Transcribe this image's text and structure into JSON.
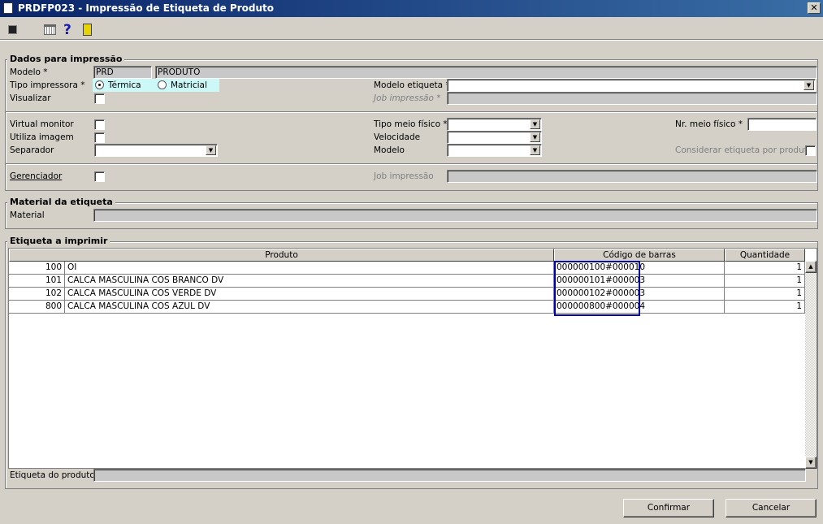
{
  "window": {
    "title": "PRDFP023 - Impressão de Etiqueta de Produto",
    "close": "✕"
  },
  "toolbar": {
    "icons": [
      "export-icon",
      "calendar-icon",
      "help-icon",
      "exit-icon"
    ],
    "help_glyph": "?"
  },
  "dados": {
    "title": "Dados para impressão",
    "modelo_label": "Modelo *",
    "modelo_code": "PRD",
    "modelo_desc": "PRODUTO",
    "tipo_label": "Tipo impressora *",
    "termica": "Térmica",
    "matricial": "Matricial",
    "selected": "Térmica",
    "visualizar_label": "Visualizar",
    "modelo_etiqueta_label": "Modelo etiqueta *",
    "job_label": "Job impressão *",
    "virtual_label": "Virtual monitor",
    "utiliza_label": "Utiliza imagem",
    "separador_label": "Separador",
    "tipo_meio_label": "Tipo meio físico *",
    "velocidade_label": "Velocidade",
    "modelo2_label": "Modelo",
    "nr_meio_label": "Nr. meio físico *",
    "considerar_label": "Considerar etiqueta por produto",
    "gerenciador_label": "Gerenciador",
    "job2_label": "Job impressão"
  },
  "material": {
    "title": "Material da etiqueta",
    "label": "Material"
  },
  "etiqueta": {
    "title": "Etiqueta a imprimir",
    "columns": [
      "Produto",
      "Código de barras",
      "Quantidade"
    ],
    "rows": [
      {
        "code": "100",
        "name": "OI",
        "barcode": "000000100#000010",
        "qty": "1"
      },
      {
        "code": "101",
        "name": "CALCA MASCULINA COS BRANCO DV",
        "barcode": "000000101#000003",
        "qty": "1"
      },
      {
        "code": "102",
        "name": "CALCA MASCULINA COS VERDE DV",
        "barcode": "000000102#000003",
        "qty": "1"
      },
      {
        "code": "800",
        "name": "CALCA MASCULINA COS AZUL DV",
        "barcode": "000000800#000004",
        "qty": "1"
      }
    ],
    "footer_label": "Etiqueta do produto",
    "highlight_color": "#0000aa"
  },
  "buttons": {
    "confirm": "Confirmar",
    "cancel": "Cancelar"
  }
}
